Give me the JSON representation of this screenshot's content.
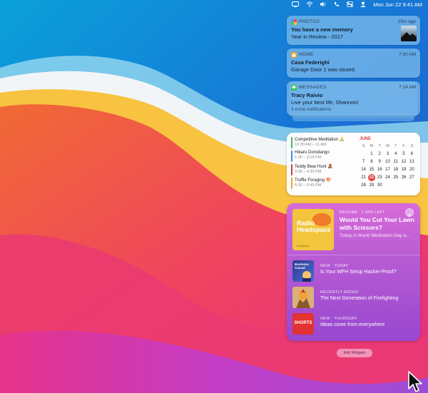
{
  "menubar": {
    "date_time": "Mon Jun 22  9:41 AM",
    "icons": [
      "display-icon",
      "wifi-icon",
      "volume-icon",
      "phone-icon",
      "control-center-icon",
      "user-icon"
    ]
  },
  "notifications": [
    {
      "app": "PHOTOS",
      "time": "25m ago",
      "title": "You have a new memory",
      "body": "Year in Review - 2017",
      "icon_color": "#f7b24d"
    },
    {
      "app": "HOME",
      "time": "7:30 AM",
      "title": "Casa Federighi",
      "body": "Garage Door 1 was closed.",
      "icon_color": "#f5a623"
    },
    {
      "app": "MESSAGES",
      "time": "7:14 AM",
      "title": "Tracy Raivio",
      "body": "Live your best life, Shannon!",
      "more": "3 more notifications",
      "icon_color": "#34c759"
    }
  ],
  "calendar": {
    "events": [
      {
        "title": "Competitive Meditation 🙏",
        "time": "10:30 AM – 11 AM",
        "color": "#3dbd4f"
      },
      {
        "title": "Hikaru Dorodango",
        "time": "1:30 – 2:15 PM",
        "color": "#3b8ff0"
      },
      {
        "title": "Teddy Bear Hunt 🧸",
        "time": "3:30 – 4:30 PM",
        "color": "#c43c4a"
      },
      {
        "title": "Truffle Foraging 🍄",
        "time": "5:30 – 6:45 PM",
        "color": "#f0a030"
      }
    ],
    "month": "JUNE",
    "weekdays": [
      "S",
      "M",
      "T",
      "W",
      "T",
      "F",
      "S"
    ],
    "weeks": [
      [
        "",
        "1",
        "2",
        "3",
        "4",
        "5",
        "6"
      ],
      [
        "7",
        "8",
        "9",
        "10",
        "11",
        "12",
        "13"
      ],
      [
        "14",
        "15",
        "16",
        "17",
        "18",
        "19",
        "20"
      ],
      [
        "21",
        "22",
        "23",
        "24",
        "25",
        "26",
        "27"
      ],
      [
        "28",
        "29",
        "30",
        "",
        "",
        "",
        ""
      ]
    ],
    "today": "22"
  },
  "podcasts": {
    "main": {
      "label": "RESUME · 1 MIN LEFT",
      "title": "Would You Cut Your Lawn with Scissors?",
      "subtitle": "Today is World Meditation Day a...",
      "art_text": "Radio Headspace",
      "art_footer": "headspace"
    },
    "episodes": [
      {
        "label": "NEW · TODAY",
        "title": "Is Your WFH Setup Hacker-Proof?",
        "art_text": "Business Casual"
      },
      {
        "label": "RECENTLY ADDED",
        "title": "The Next Generation of Firefighting",
        "art_text": ""
      },
      {
        "label": "NEW · THURSDAY",
        "title": "Ideas come from everywhere",
        "art_text": "SHORTS"
      }
    ]
  },
  "edit_widgets_label": "Edit Widgets",
  "colors": {
    "accent_red": "#e23b3b",
    "podcast_purple": "#b55ad4",
    "notification_blue": "#78b9eb"
  }
}
